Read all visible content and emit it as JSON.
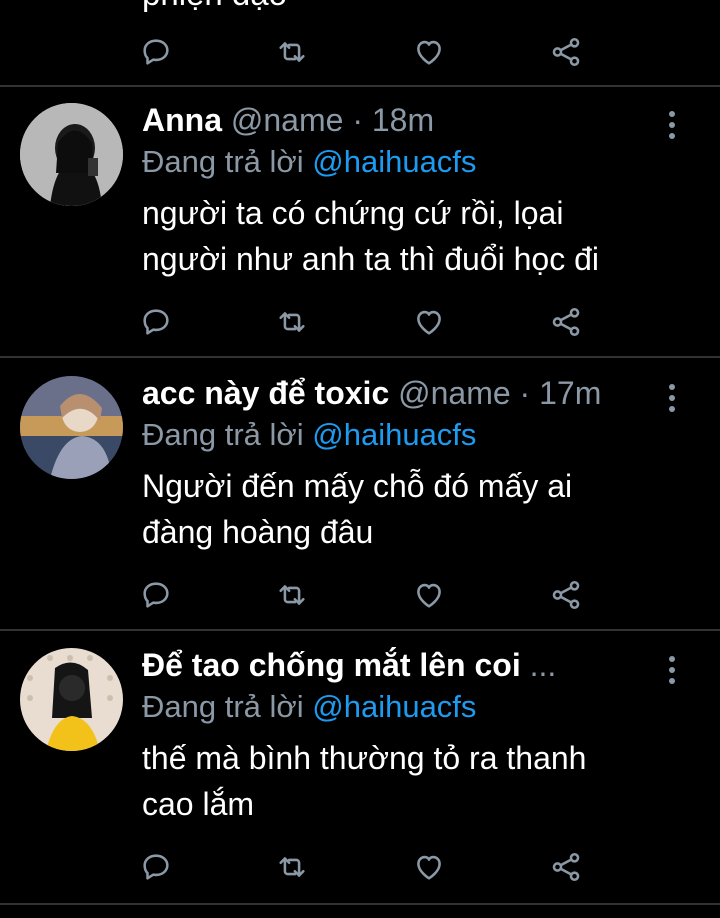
{
  "top_tweet": {
    "cut_text": "phiện đạo"
  },
  "tweets": [
    {
      "display_name": "Anna",
      "handle": "@name",
      "separator": "·",
      "time": "18m",
      "reply_prefix": "Đang trả lời",
      "reply_to": "@haihuacfs",
      "body_line1": "người ta có chứng cứ rồi, lọai",
      "body_line2": "người như anh ta thì đuổi học đi",
      "avatar": "avatar-girl-dark"
    },
    {
      "display_name": "acc này để toxic",
      "handle": "@name",
      "separator": "·",
      "time": "17m",
      "reply_prefix": "Đang trả lời",
      "reply_to": "@haihuacfs",
      "body_line1": "Người đến mấy chỗ đó mấy ai",
      "body_line2": "đàng hoàng đâu",
      "avatar": "avatar-girl-sunset"
    },
    {
      "display_name": "Để tao chống mắt lên coi",
      "ellipsis": "...",
      "reply_prefix": "Đang trả lời",
      "reply_to": "@haihuacfs",
      "body_line1": "thế mà bình thường tỏ ra thanh",
      "body_line2": "cao lắm",
      "avatar": "avatar-girl-yellow"
    }
  ],
  "icons": {
    "reply": "reply-icon",
    "retweet": "retweet-icon",
    "like": "like-icon",
    "share": "share-icon",
    "more": "more-icon"
  },
  "colors": {
    "background": "#000000",
    "text": "#ffffff",
    "muted": "#8b98a5",
    "mention": "#1d9bf0",
    "divider": "#2f3336"
  }
}
